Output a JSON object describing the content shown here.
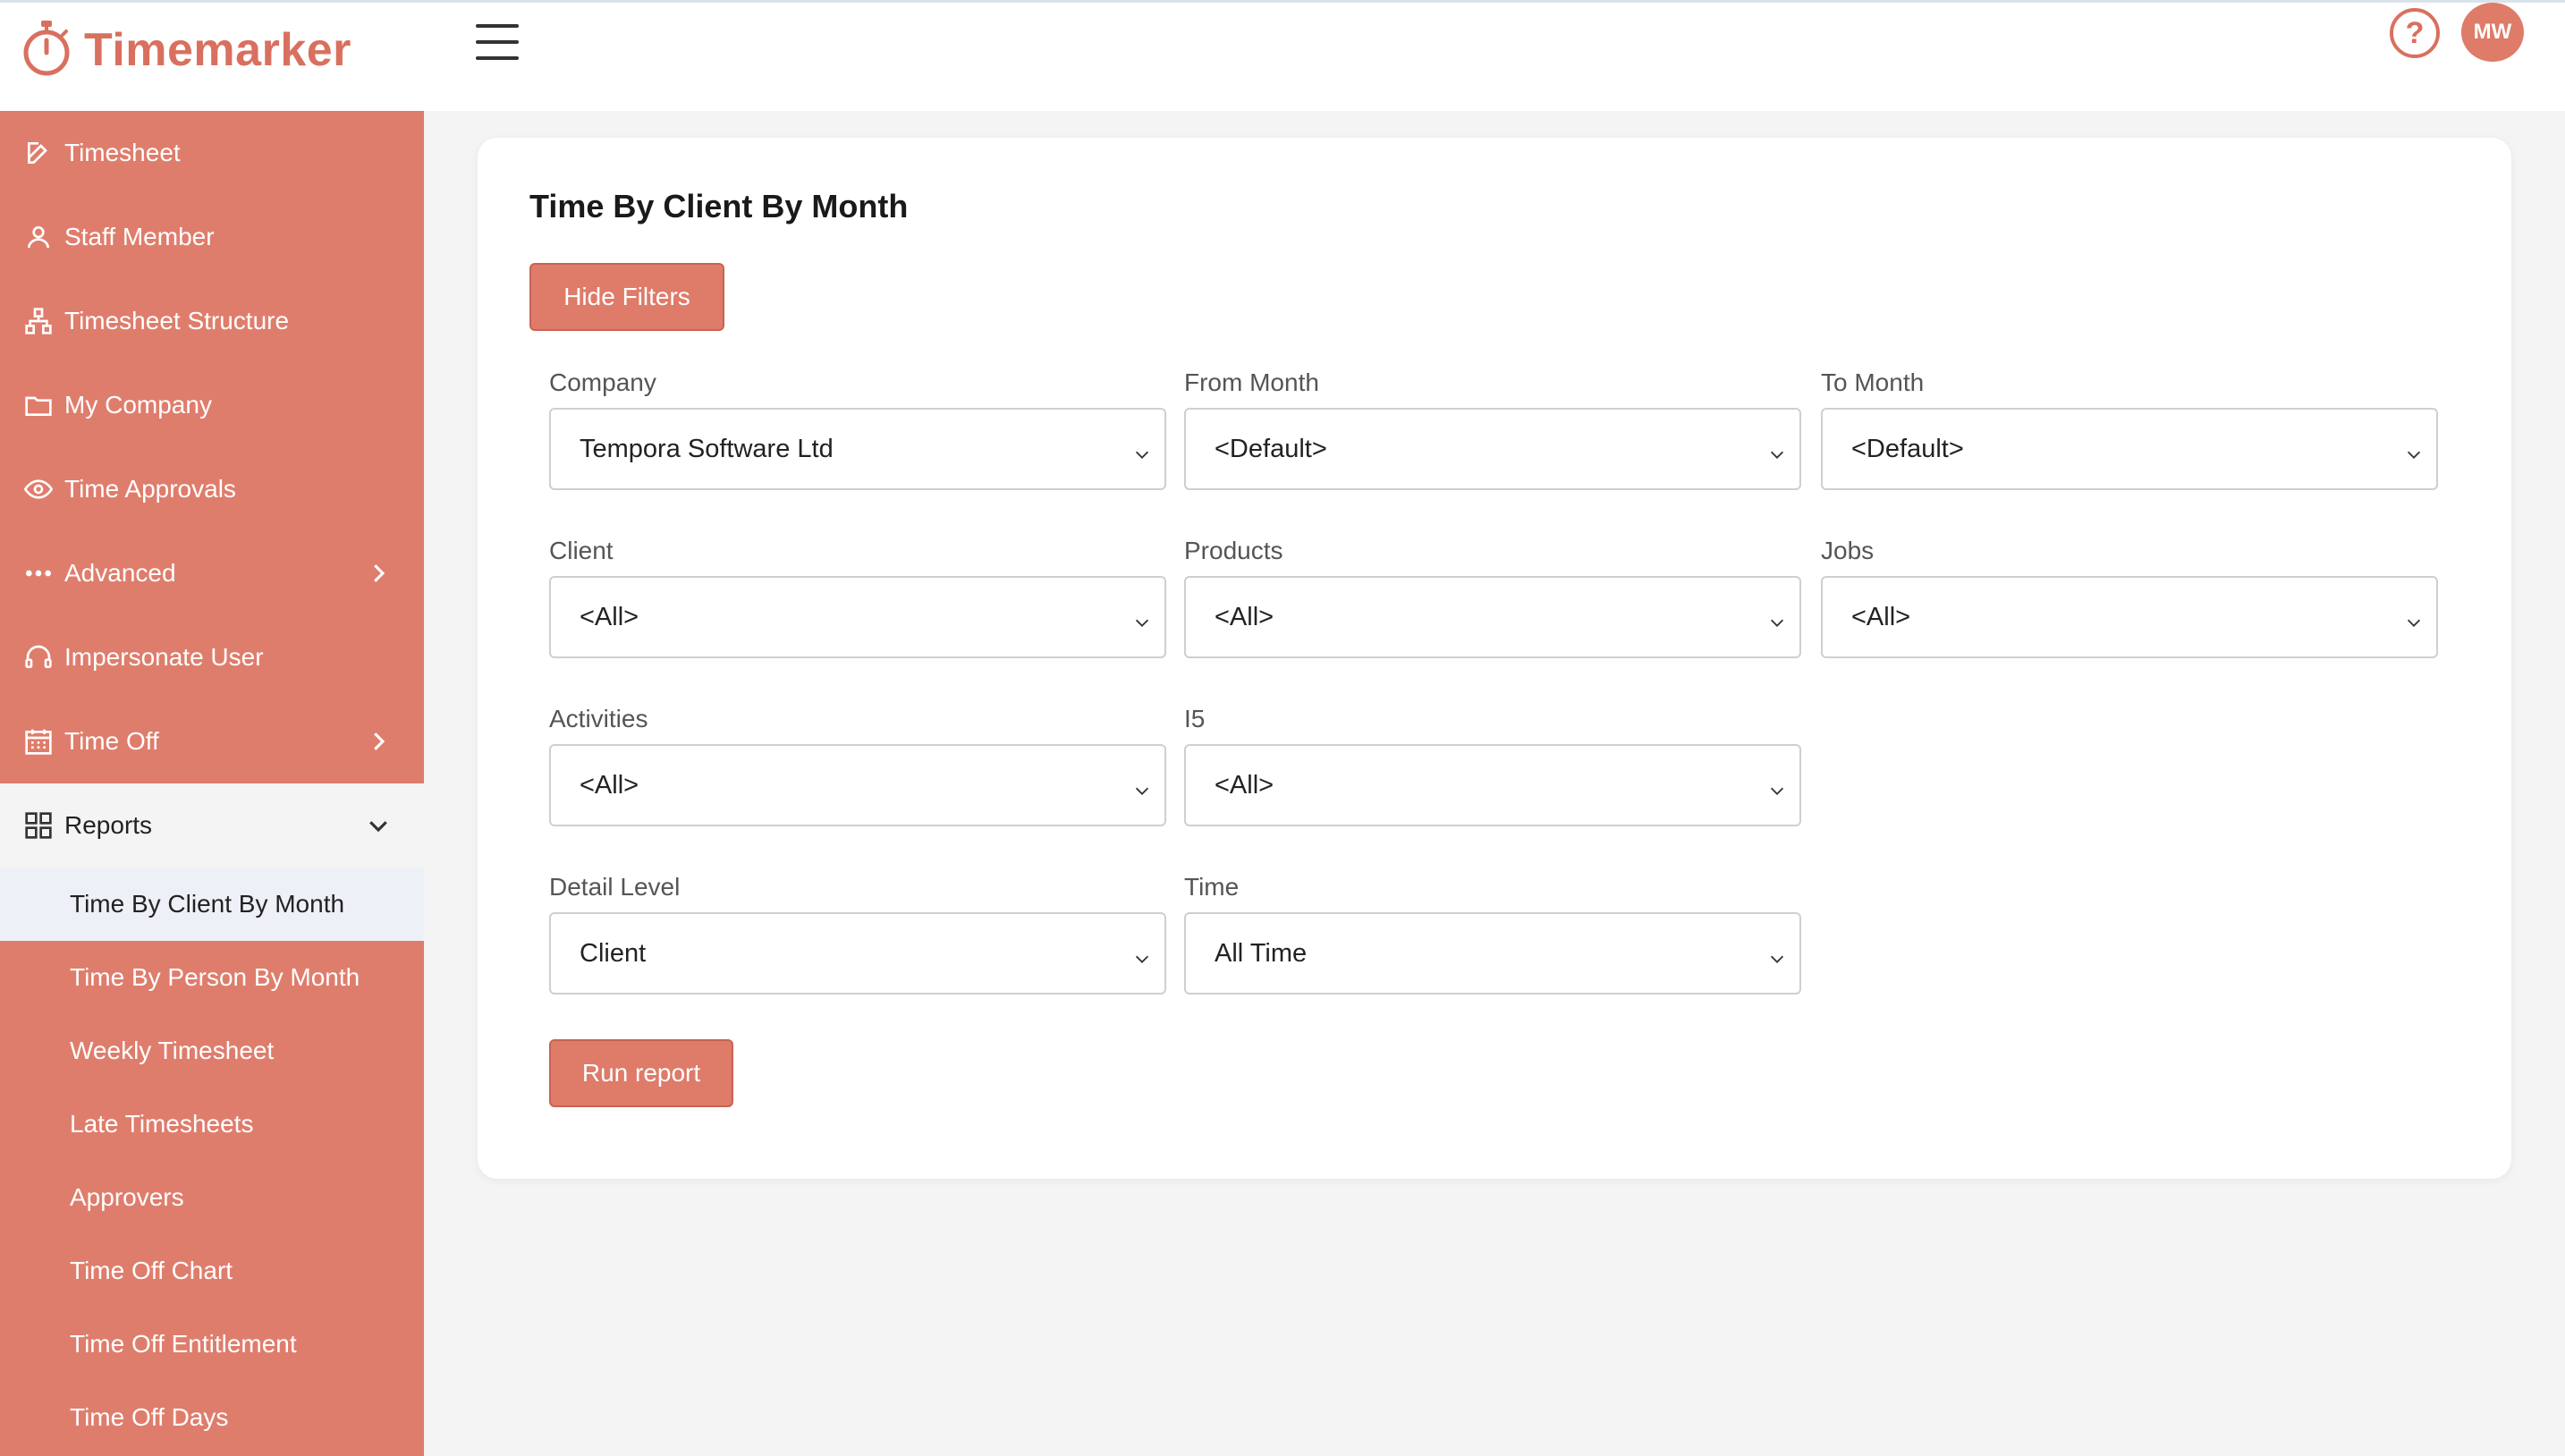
{
  "app": {
    "name": "Timemarker",
    "user_initials": "MW",
    "help_symbol": "?"
  },
  "sidebar": {
    "items": [
      {
        "label": "Timesheet",
        "icon": "edit-icon"
      },
      {
        "label": "Staff Member",
        "icon": "user-icon"
      },
      {
        "label": "Timesheet Structure",
        "icon": "hierarchy-icon"
      },
      {
        "label": "My Company",
        "icon": "folder-icon"
      },
      {
        "label": "Time Approvals",
        "icon": "eye-icon"
      },
      {
        "label": "Advanced",
        "icon": "more-dots-icon",
        "expandable": true
      },
      {
        "label": "Impersonate User",
        "icon": "headset-icon"
      },
      {
        "label": "Time Off",
        "icon": "calendar-icon",
        "expandable": true
      }
    ],
    "reports": {
      "label": "Reports",
      "icon": "grid-icon",
      "expanded": true,
      "sub_items": [
        "Time By Client By Month",
        "Time By Person By Month",
        "Weekly Timesheet",
        "Late Timesheets",
        "Approvers",
        "Time Off Chart",
        "Time Off Entitlement",
        "Time Off Days"
      ],
      "active_sub_item": "Time By Client By Month"
    }
  },
  "main": {
    "title": "Time By Client By Month",
    "hide_filters_label": "Hide Filters",
    "run_report_label": "Run report",
    "filters": {
      "company": {
        "label": "Company",
        "value": "Tempora Software Ltd"
      },
      "from_month": {
        "label": "From Month",
        "value": "<Default>"
      },
      "to_month": {
        "label": "To Month",
        "value": "<Default>"
      },
      "client": {
        "label": "Client",
        "value": "<All>"
      },
      "products": {
        "label": "Products",
        "value": "<All>"
      },
      "jobs": {
        "label": "Jobs",
        "value": "<All>"
      },
      "activities": {
        "label": "Activities",
        "value": "<All>"
      },
      "i5": {
        "label": "I5",
        "value": "<All>"
      },
      "detail_level": {
        "label": "Detail Level",
        "value": "Client"
      },
      "time": {
        "label": "Time",
        "value": "All Time"
      }
    }
  },
  "colors": {
    "accent": "#df7d6c",
    "button": "#de7b69",
    "active_bg": "#eef0f7",
    "page_bg": "#f4f4f4"
  }
}
